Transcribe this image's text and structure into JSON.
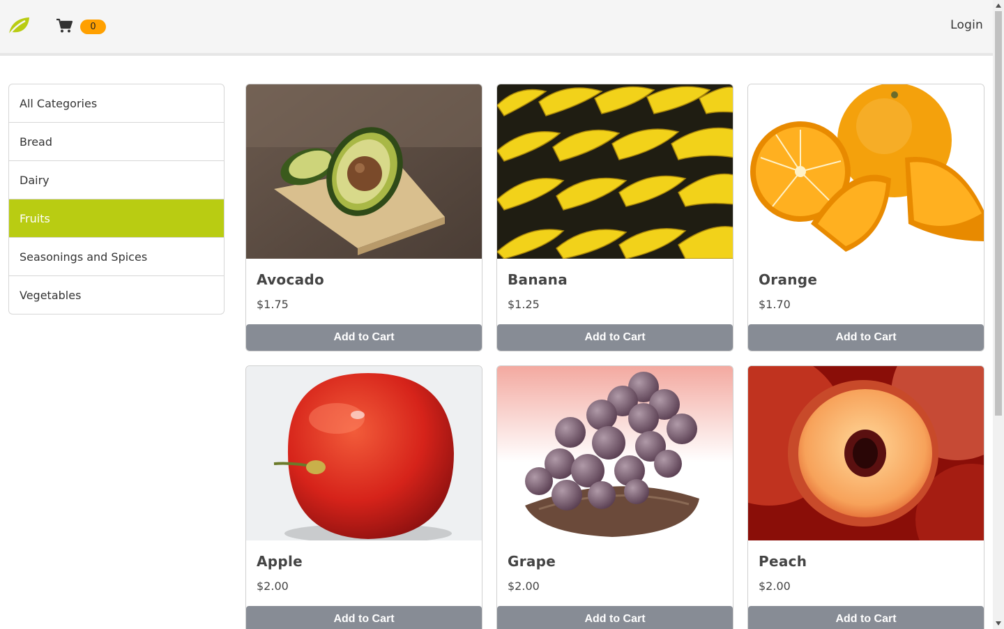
{
  "header": {
    "logo_icon": "leaf-icon",
    "cart_icon": "cart-icon",
    "cart_count": "0",
    "login_label": "Login",
    "brand_color": "#b9cc12",
    "badge_color": "#ffa000"
  },
  "sidebar": {
    "items": [
      {
        "label": "All Categories"
      },
      {
        "label": "Bread"
      },
      {
        "label": "Dairy"
      },
      {
        "label": "Fruits"
      },
      {
        "label": "Seasonings and Spices"
      },
      {
        "label": "Vegetables"
      }
    ],
    "active": "Fruits"
  },
  "products": [
    {
      "name": "Avocado",
      "price": "$1.75",
      "button": "Add to Cart"
    },
    {
      "name": "Banana",
      "price": "$1.25",
      "button": "Add to Cart"
    },
    {
      "name": "Orange",
      "price": "$1.70",
      "button": "Add to Cart"
    },
    {
      "name": "Apple",
      "price": "$2.00",
      "button": "Add to Cart"
    },
    {
      "name": "Grape",
      "price": "$2.00",
      "button": "Add to Cart"
    },
    {
      "name": "Peach",
      "price": "$2.00",
      "button": "Add to Cart"
    }
  ]
}
